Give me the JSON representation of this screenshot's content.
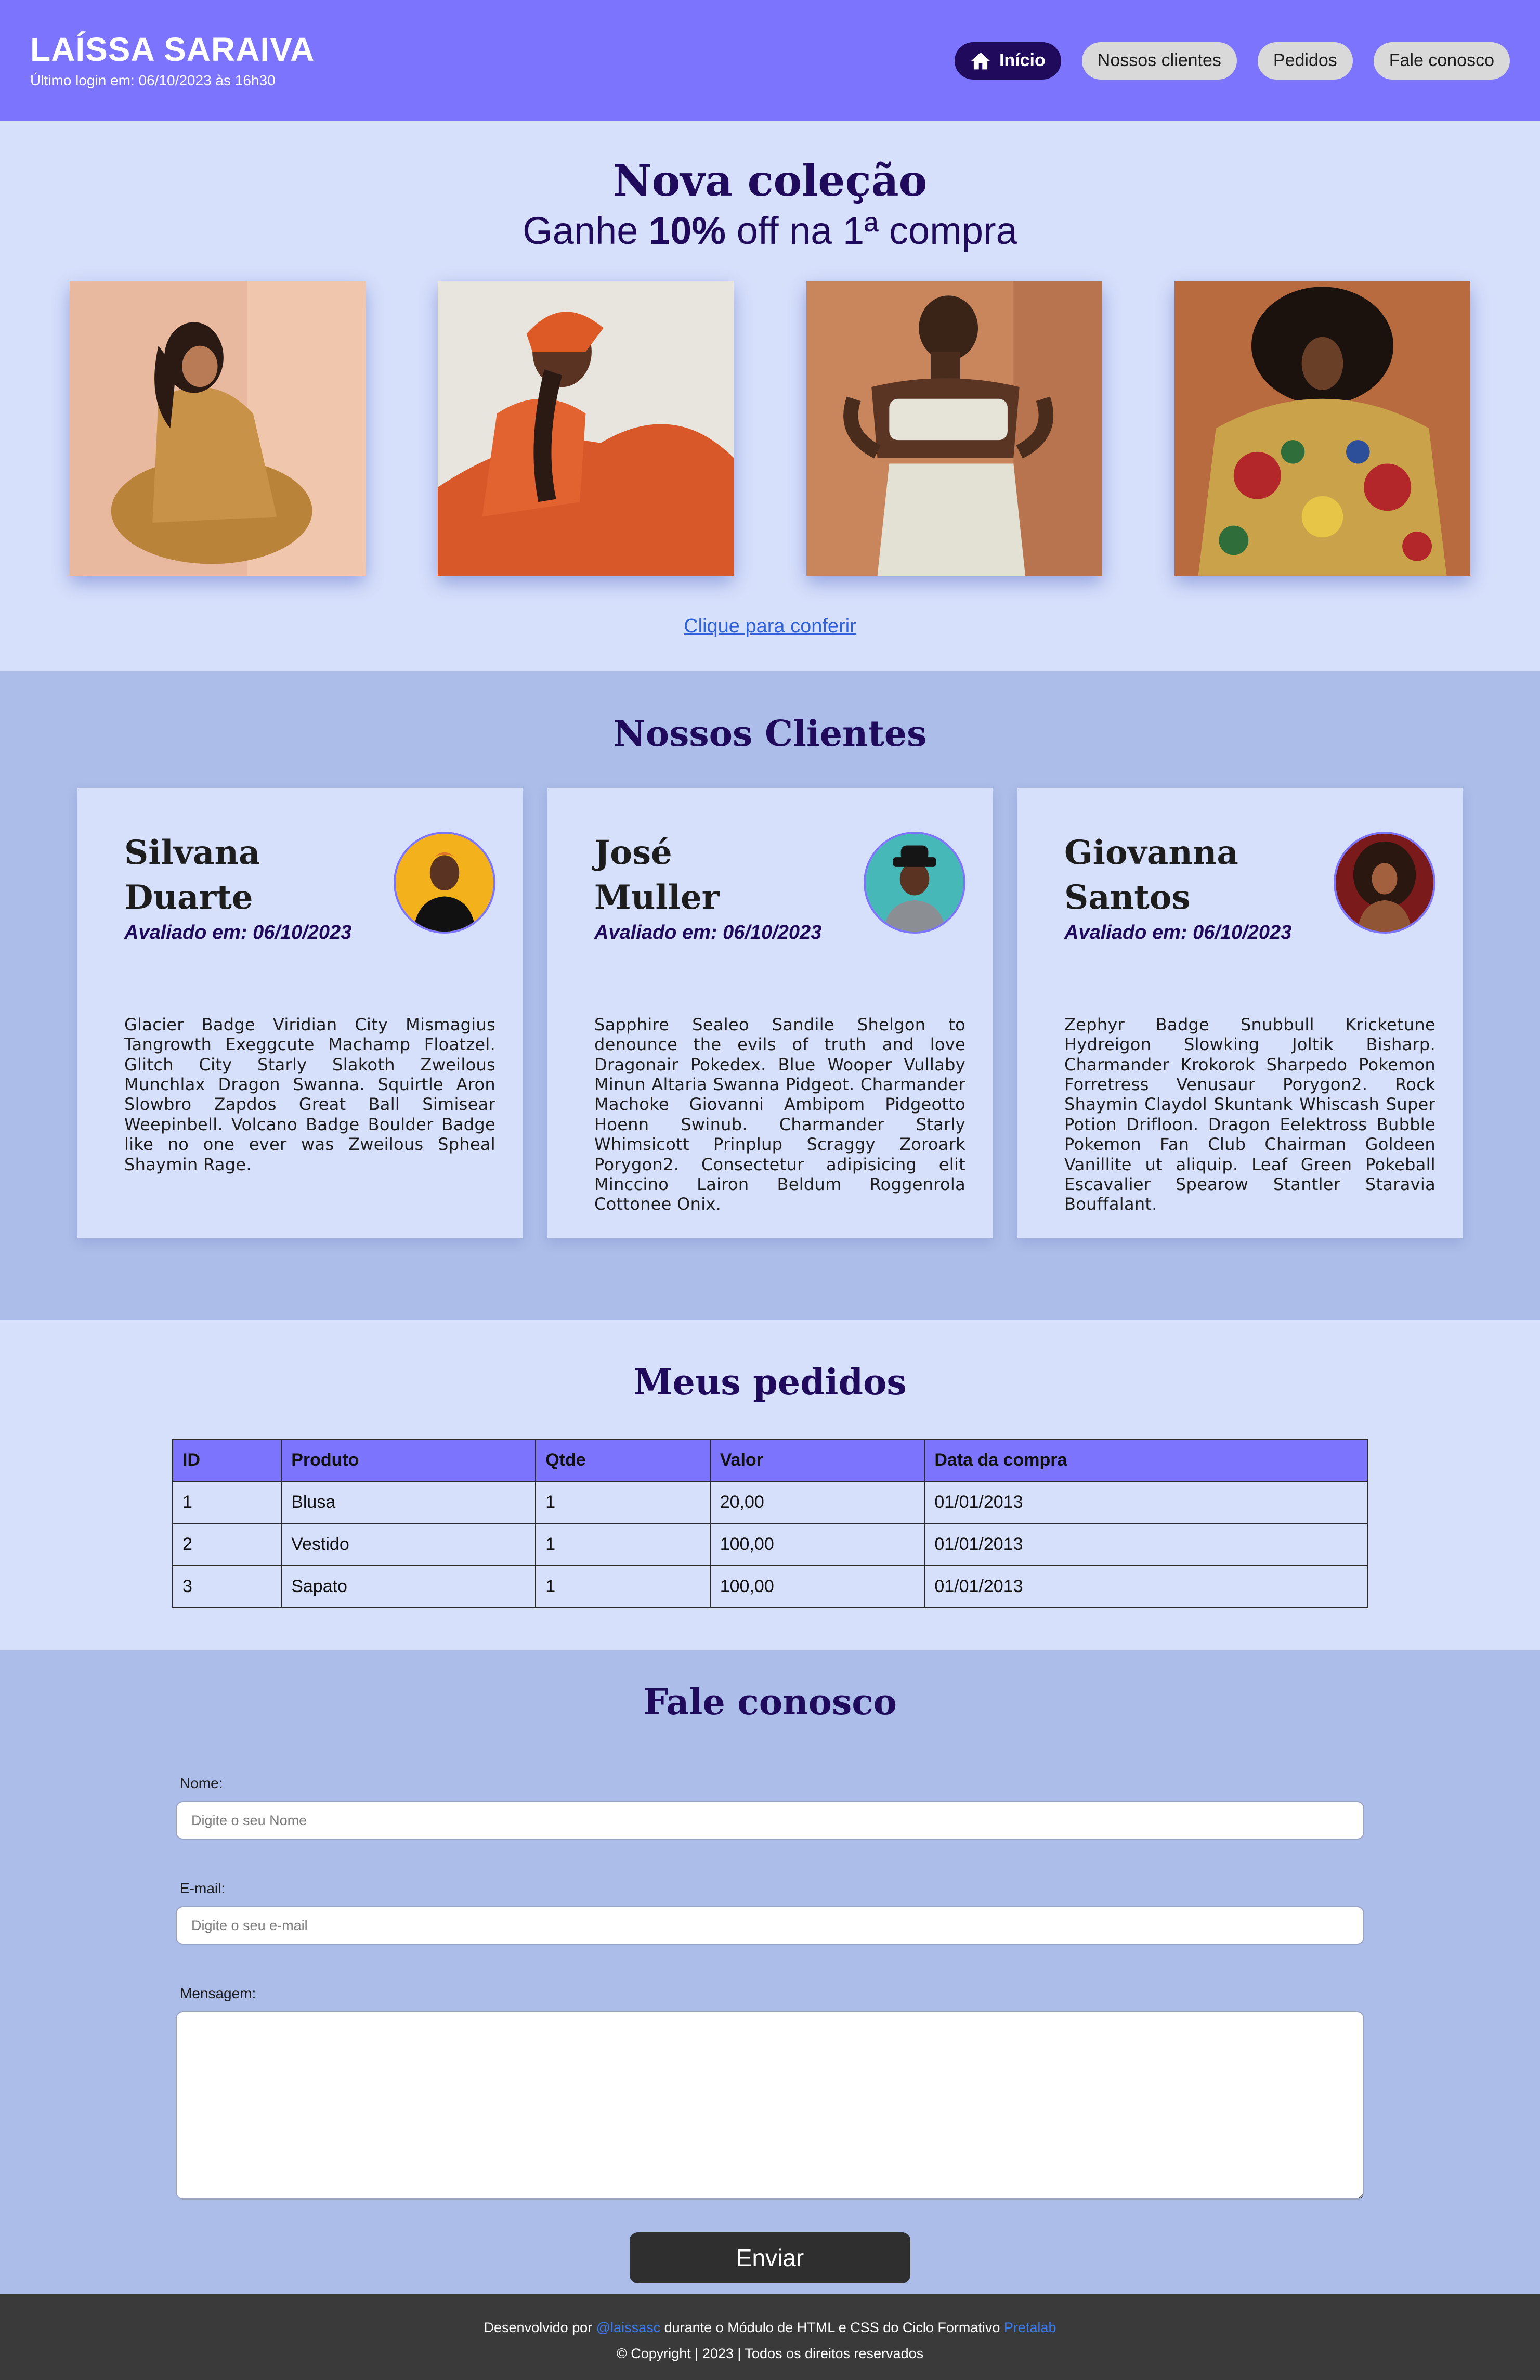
{
  "header": {
    "title": "LAÍSSA SARAIVA",
    "last_login": "Último login em: 06/10/2023 às 16h30",
    "nav": [
      {
        "label": "Início",
        "icon": "home-icon",
        "active": true
      },
      {
        "label": "Nossos clientes"
      },
      {
        "label": "Pedidos"
      },
      {
        "label": "Fale conosco"
      }
    ]
  },
  "hero": {
    "title": "Nova coleção",
    "subtitle_pre": "Ganhe ",
    "subtitle_bold": "10%",
    "subtitle_post": " off na 1ª compra",
    "link": "Clique para conferir"
  },
  "clients": {
    "title": "Nossos Clientes",
    "items": [
      {
        "name_first": "Silvana",
        "name_last": "Duarte",
        "date": "Avaliado em: 06/10/2023",
        "text": "Glacier Badge Viridian City Mismagius Tangrowth Exeggcute Machamp Floatzel. Glitch City Starly Slakoth Zweilous Munchlax Dragon Swanna. Squirtle Aron Slowbro Zapdos Great Ball Simisear Weepinbell. Volcano Badge Boulder Badge like no one ever was Zweilous Spheal Shaymin Rage."
      },
      {
        "name_first": "José",
        "name_last": "Muller",
        "date": "Avaliado em: 06/10/2023",
        "text": "Sapphire Sealeo Sandile Shelgon to denounce the evils of truth and love Dragonair Pokedex. Blue Wooper Vullaby Minun Altaria Swanna Pidgeot. Charmander Machoke Giovanni Ambipom Pidgeotto Hoenn Swinub. Charmander Starly Whimsicott Prinplup Scraggy Zoroark Porygon2. Consectetur adipisicing elit Minccino Lairon Beldum Roggenrola Cottonee Onix."
      },
      {
        "name_first": "Giovanna",
        "name_last": "Santos",
        "date": "Avaliado em: 06/10/2023",
        "text": "Zephyr Badge Snubbull Kricketune Hydreigon Slowking Joltik Bisharp. Charmander Krokorok Sharpedo Pokemon Forretress Venusaur Porygon2. Rock Shaymin Claydol Skuntank Whiscash Super Potion Drifloon. Dragon Eelektross Bubble Pokemon Fan Club Chairman Goldeen Vanillite ut aliquip. Leaf Green Pokeball Escavalier Spearow Stantler Staravia Bouffalant."
      }
    ]
  },
  "orders": {
    "title": "Meus pedidos",
    "columns": [
      "ID",
      "Produto",
      "Qtde",
      "Valor",
      "Data da compra"
    ],
    "rows": [
      [
        "1",
        "Blusa",
        "1",
        "20,00",
        "01/01/2013"
      ],
      [
        "2",
        "Vestido",
        "1",
        "100,00",
        "01/01/2013"
      ],
      [
        "3",
        "Sapato",
        "1",
        "100,00",
        "01/01/2013"
      ]
    ]
  },
  "contact": {
    "title": "Fale conosco",
    "name_label": "Nome:",
    "name_placeholder": "Digite o seu Nome",
    "email_label": "E-mail:",
    "email_placeholder": "Digite o seu e-mail",
    "message_label": "Mensagem:",
    "submit": "Enviar"
  },
  "footer": {
    "pre": "Desenvolvido por ",
    "author": "@laissasc",
    "mid": " durante o Módulo de HTML e CSS do Ciclo Formativo ",
    "org": "Pretalab",
    "copyright": "© Copyright | 2023 | Todos os direitos reservados"
  },
  "colors": {
    "header_bg": "#7d74fe",
    "accent_dark": "#1f0a5c",
    "light_bg": "#d7e0fb",
    "alt_bg": "#adbde9",
    "link": "#2f62d9",
    "footer_bg": "#3a3a3a"
  }
}
